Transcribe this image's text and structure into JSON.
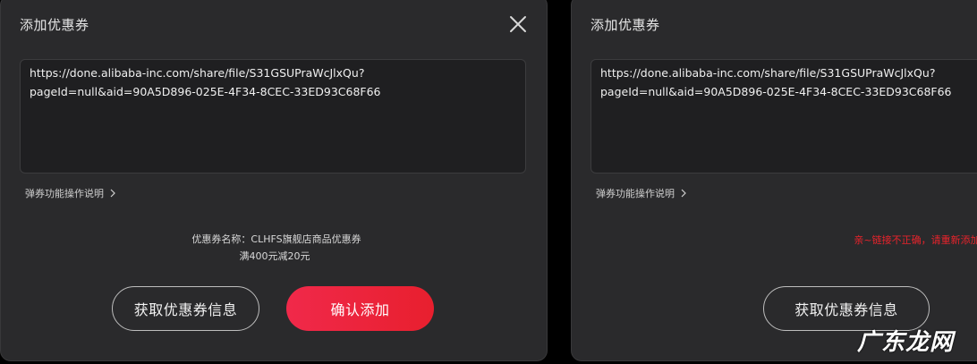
{
  "left_dialog": {
    "title": "添加优惠券",
    "url_value": "https://done.alibaba-inc.com/share/file/S31GSUPraWcJlxQu?\npageId=null&aid=90A5D896-025E-4F34-8CEC-33ED93C68F66",
    "help_link": "弹券功能操作说明",
    "coupon_name_line": "优惠券名称：CLHFS旗舰店商品优惠券",
    "coupon_rule_line": "满400元减20元",
    "fetch_button": "获取优惠券信息",
    "confirm_button": "确认添加"
  },
  "right_dialog": {
    "title": "添加优惠券",
    "url_value": "https://done.alibaba-inc.com/share/file/S31GSUPraWcJlxQu?\npageId=null&aid=90A5D896-025E-4F34-8CEC-33ED93C68F66",
    "help_link": "弹券功能操作说明",
    "error_message": "亲~链接不正确，请重新添加",
    "fetch_button": "获取优惠券信息"
  },
  "watermark": "广东龙网",
  "icons": {
    "close": "close-icon",
    "chevron": "chevron-right-icon"
  },
  "colors": {
    "panel_bg": "#2a2a2c",
    "input_bg": "#1f1f21",
    "accent_red": "#e8232b",
    "text_primary": "#f0f0f0"
  }
}
